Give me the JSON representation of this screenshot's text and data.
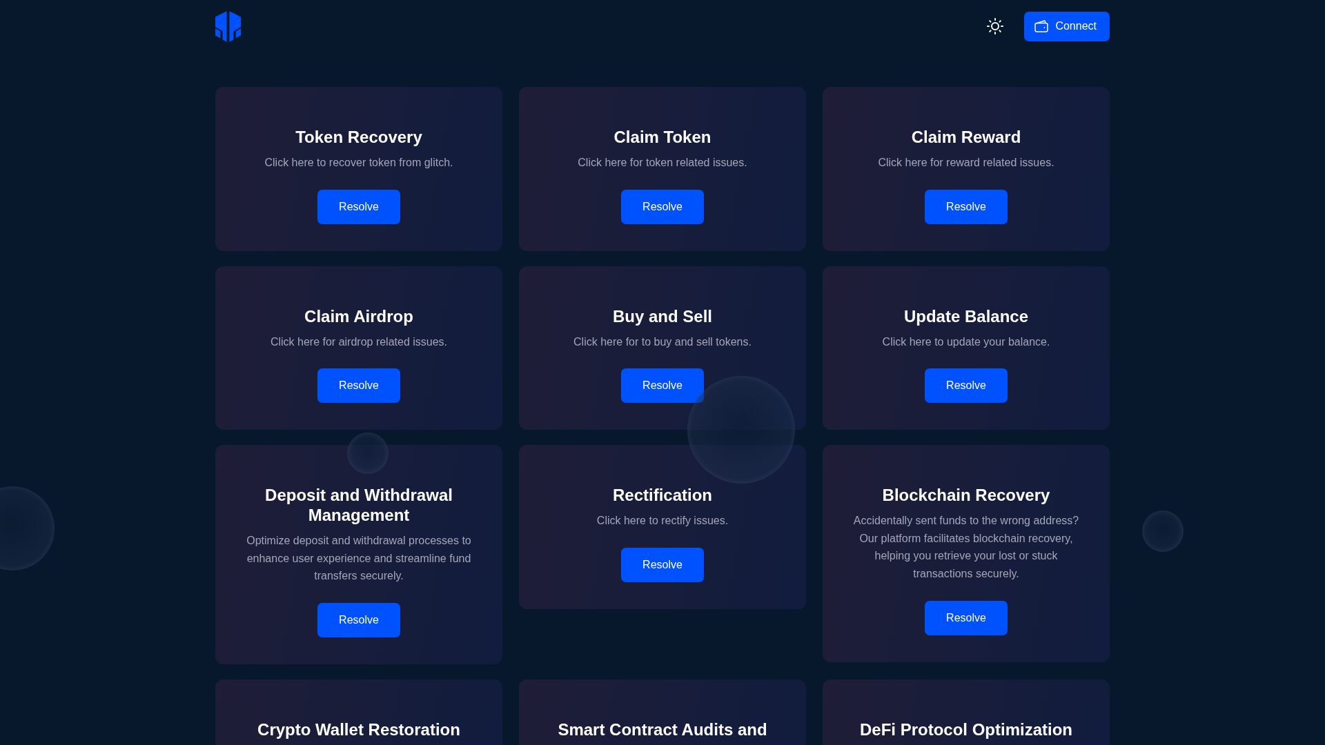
{
  "header": {
    "connect_button": {
      "label": "Connect"
    }
  },
  "cards": [
    {
      "title": "Token Recovery",
      "description": "Click here to recover token from glitch.",
      "button": "Resolve"
    },
    {
      "title": "Claim Token",
      "description": "Click here for token related issues.",
      "button": "Resolve"
    },
    {
      "title": "Claim Reward",
      "description": "Click here for reward related issues.",
      "button": "Resolve"
    },
    {
      "title": "Claim Airdrop",
      "description": "Click here for airdrop related issues.",
      "button": "Resolve"
    },
    {
      "title": "Buy and Sell",
      "description": "Click here for to buy and sell tokens.",
      "button": "Resolve"
    },
    {
      "title": "Update Balance",
      "description": "Click here to update your balance.",
      "button": "Resolve"
    },
    {
      "title": "Deposit and Withdrawal Management",
      "description": "Optimize deposit and withdrawal processes to enhance user experience and streamline fund transfers securely.",
      "button": "Resolve"
    },
    {
      "title": "Rectification",
      "description": "Click here to rectify issues.",
      "button": "Resolve"
    },
    {
      "title": "Blockchain Recovery",
      "description": "Accidentally sent funds to the wrong address? Our platform facilitates blockchain recovery, helping you retrieve your lost or stuck transactions securely.",
      "button": "Resolve"
    },
    {
      "title": "Crypto Wallet Restoration"
    },
    {
      "title": "Smart Contract Audits and"
    },
    {
      "title": "DeFi Protocol Optimization"
    }
  ]
}
